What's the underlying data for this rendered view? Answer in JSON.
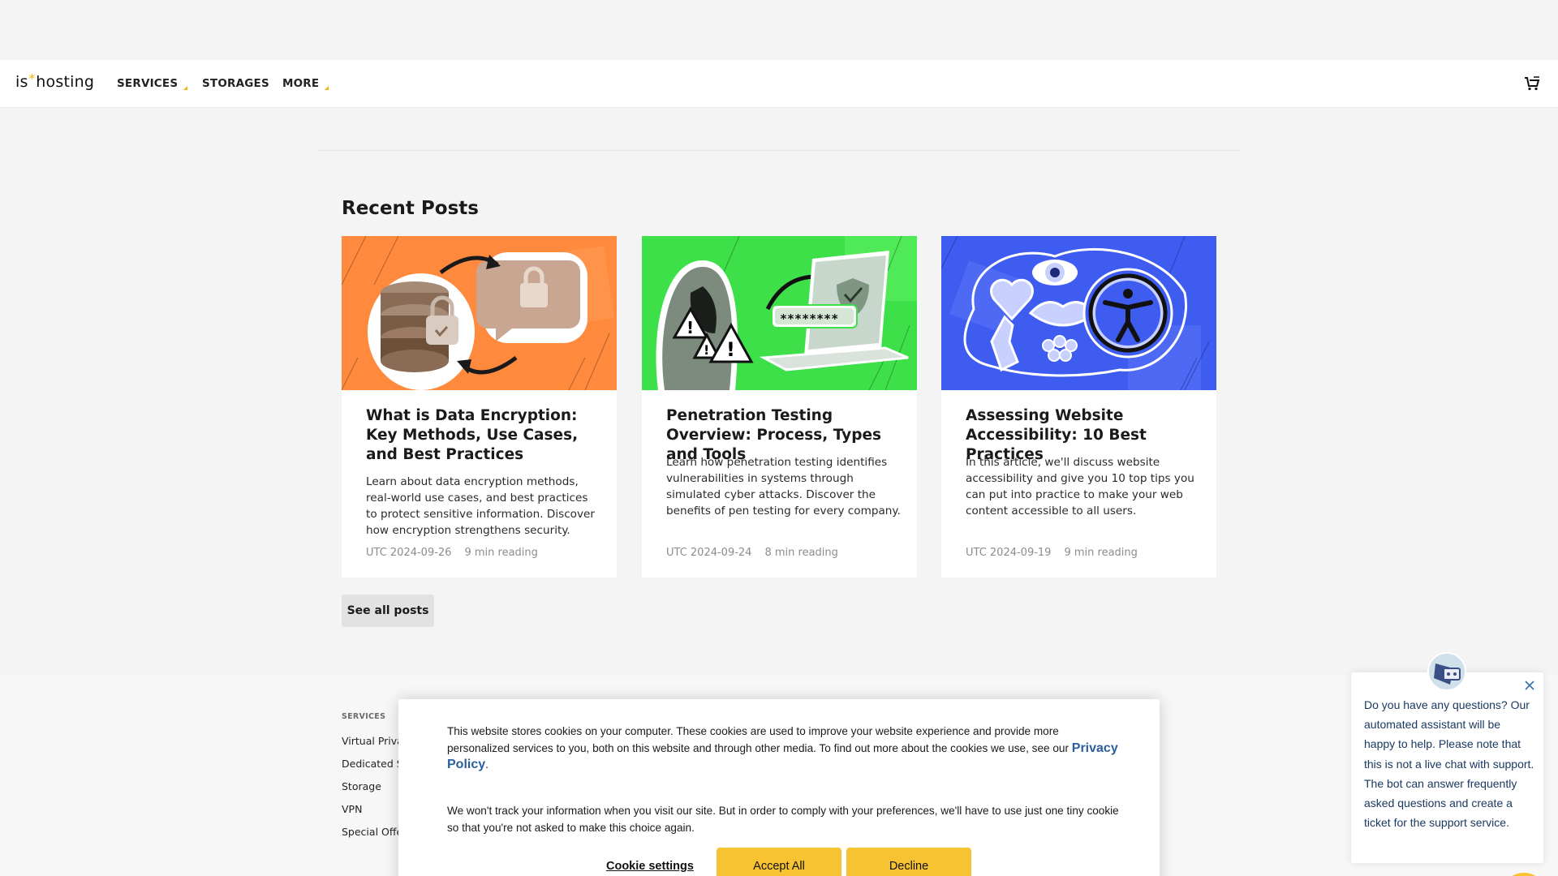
{
  "brand": {
    "left": "is",
    "right": "hosting",
    "accent": "#f5b400"
  },
  "nav": {
    "items": [
      {
        "label": "SERVICES",
        "has_dropdown": true
      },
      {
        "label": "STORAGES",
        "has_dropdown": false
      },
      {
        "label": "MORE",
        "has_dropdown": true
      }
    ],
    "cart_icon": "cart-icon"
  },
  "recent": {
    "title": "Recent Posts",
    "posts": [
      {
        "title": "What is Data Encryption: Key Methods, Use Cases, and Best Practices",
        "description": "Learn about data encryption methods, real-world use cases, and best practices to protect sensitive information. Discover how encryption strengthens security.",
        "date": "UTC 2024-09-26",
        "reading": "9 min reading",
        "image_bg": "#ff8a3d"
      },
      {
        "title": "Penetration Testing Overview: Process, Types and Tools",
        "description": "Learn how penetration testing identifies vulnerabilities in systems through simulated cyber attacks. Discover the benefits of pen testing for every company.",
        "date": "UTC 2024-09-24",
        "reading": "8 min reading",
        "image_bg": "#3ee04a",
        "password_text": "********"
      },
      {
        "title": "Assessing Website Accessibility: 10 Best Practices",
        "description": "In this article, we'll discuss website accessibility and give you 10 top tips you can put into practice to make your web content accessible to all users.",
        "date": "UTC 2024-09-19",
        "reading": "9 min reading",
        "image_bg": "#3f5cf0"
      }
    ],
    "see_all": "See all posts"
  },
  "footer": {
    "heading": "SERVICES",
    "links": [
      "Virtual Private Server",
      "Dedicated Server",
      "Storage",
      "VPN",
      "Special Offers"
    ]
  },
  "cookie": {
    "text1": "This website stores cookies on your computer. These cookies are used to improve your website experience and provide more personalized services to you, both on this website and through other media. To find out more about the cookies we use, see our",
    "policy_link": "Privacy Policy",
    "text2": "We won't track your information when you visit our site. But in order to comply with your preferences, we'll have to use just one tiny cookie so that you're not asked to make this choice again.",
    "settings": "Cookie settings",
    "accept": "Accept All",
    "decline": "Decline",
    "button_color": "#f7c332"
  },
  "chat": {
    "message": "Do you have any questions? Our automated assistant will be happy to help. Please note that this is not a live chat with support. The bot can answer frequently asked questions and create a ticket for the support service."
  }
}
